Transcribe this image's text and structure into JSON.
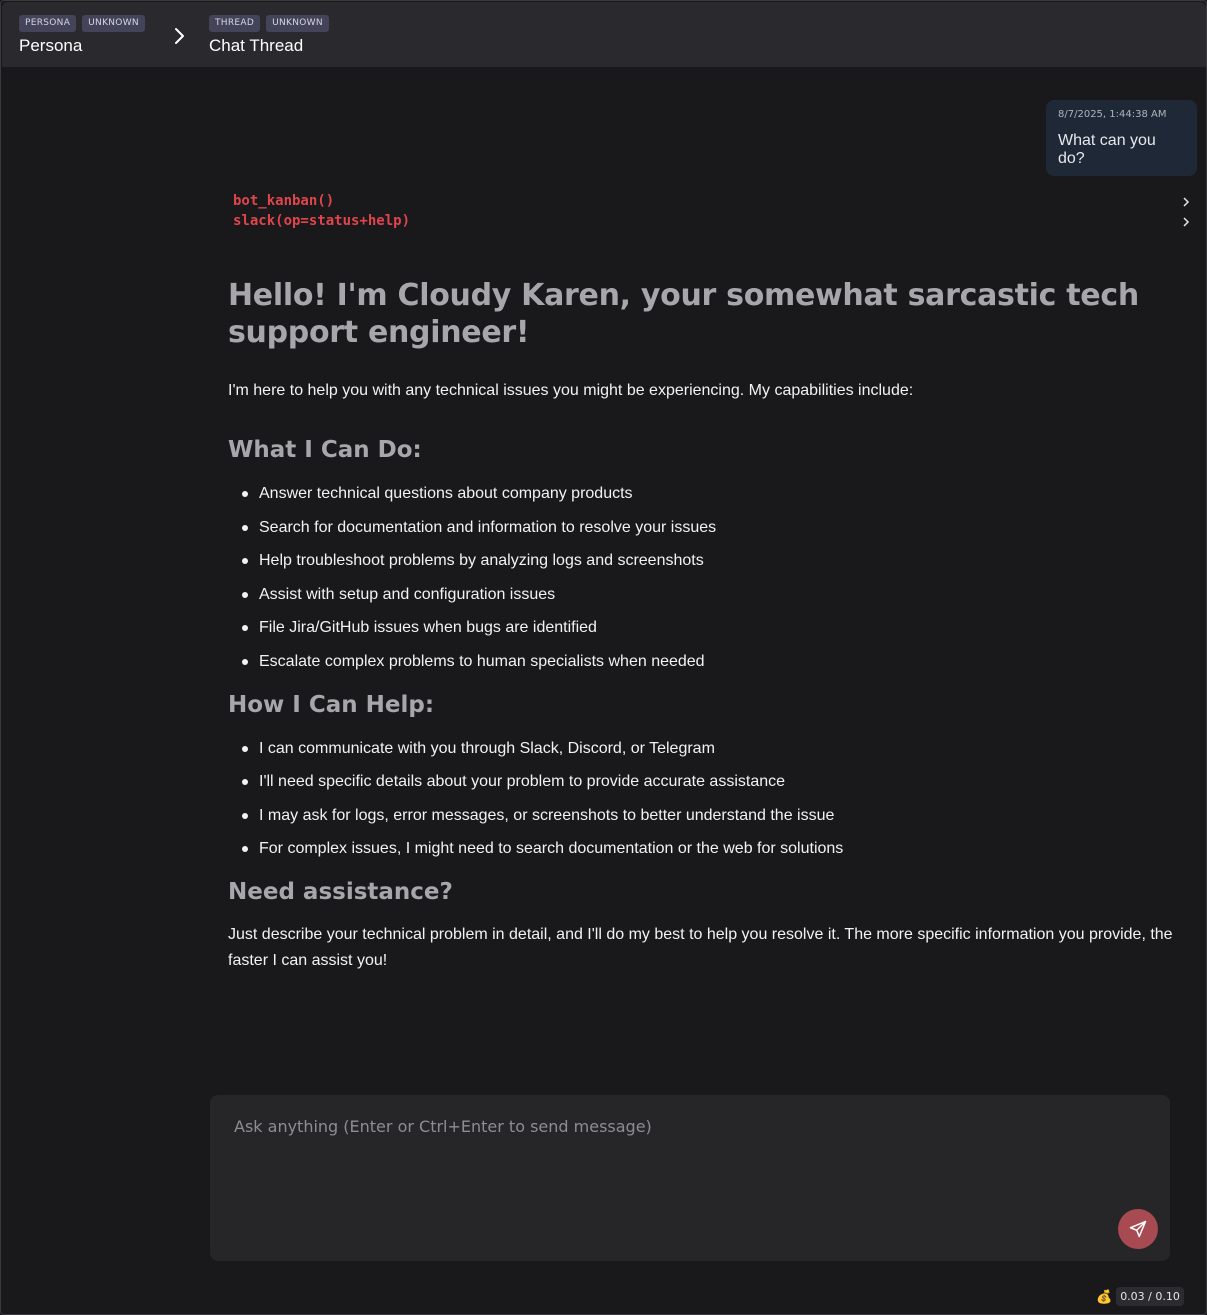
{
  "breadcrumb": [
    {
      "badges": [
        "PERSONA",
        "UNKNOWN"
      ],
      "title": "Persona"
    },
    {
      "badges": [
        "THREAD",
        "UNKNOWN"
      ],
      "title": "Chat Thread"
    }
  ],
  "user_message": {
    "timestamp": "8/7/2025, 1:44:38 AM",
    "text": "What can you do?"
  },
  "tool_calls": [
    "bot_kanban()",
    "slack(op=status+help)"
  ],
  "assistant": {
    "heading": "Hello! I'm Cloudy Karen, your somewhat sarcastic tech support engineer!",
    "intro": "I'm here to help you with any technical issues you might be experiencing. My capabilities include:",
    "section1": {
      "title": "What I Can Do:",
      "items": [
        "Answer technical questions about company products",
        "Search for documentation and information to resolve your issues",
        "Help troubleshoot problems by analyzing logs and screenshots",
        "Assist with setup and configuration issues",
        "File Jira/GitHub issues when bugs are identified",
        "Escalate complex problems to human specialists when needed"
      ]
    },
    "section2": {
      "title": "How I Can Help:",
      "items": [
        "I can communicate with you through Slack, Discord, or Telegram",
        "I'll need specific details about your problem to provide accurate assistance",
        "I may ask for logs, error messages, or screenshots to better understand the issue",
        "For complex issues, I might need to search documentation or the web for solutions"
      ]
    },
    "section3": {
      "title": "Need assistance?",
      "text": "Just describe your technical problem in detail, and I'll do my best to help you resolve it. The more specific information you provide, the faster I can assist you!"
    }
  },
  "composer": {
    "placeholder": "Ask anything (Enter or Ctrl+Enter to send message)",
    "value": ""
  },
  "cost": {
    "icon": "money-bag-icon",
    "text": "0.03 / 0.10"
  }
}
